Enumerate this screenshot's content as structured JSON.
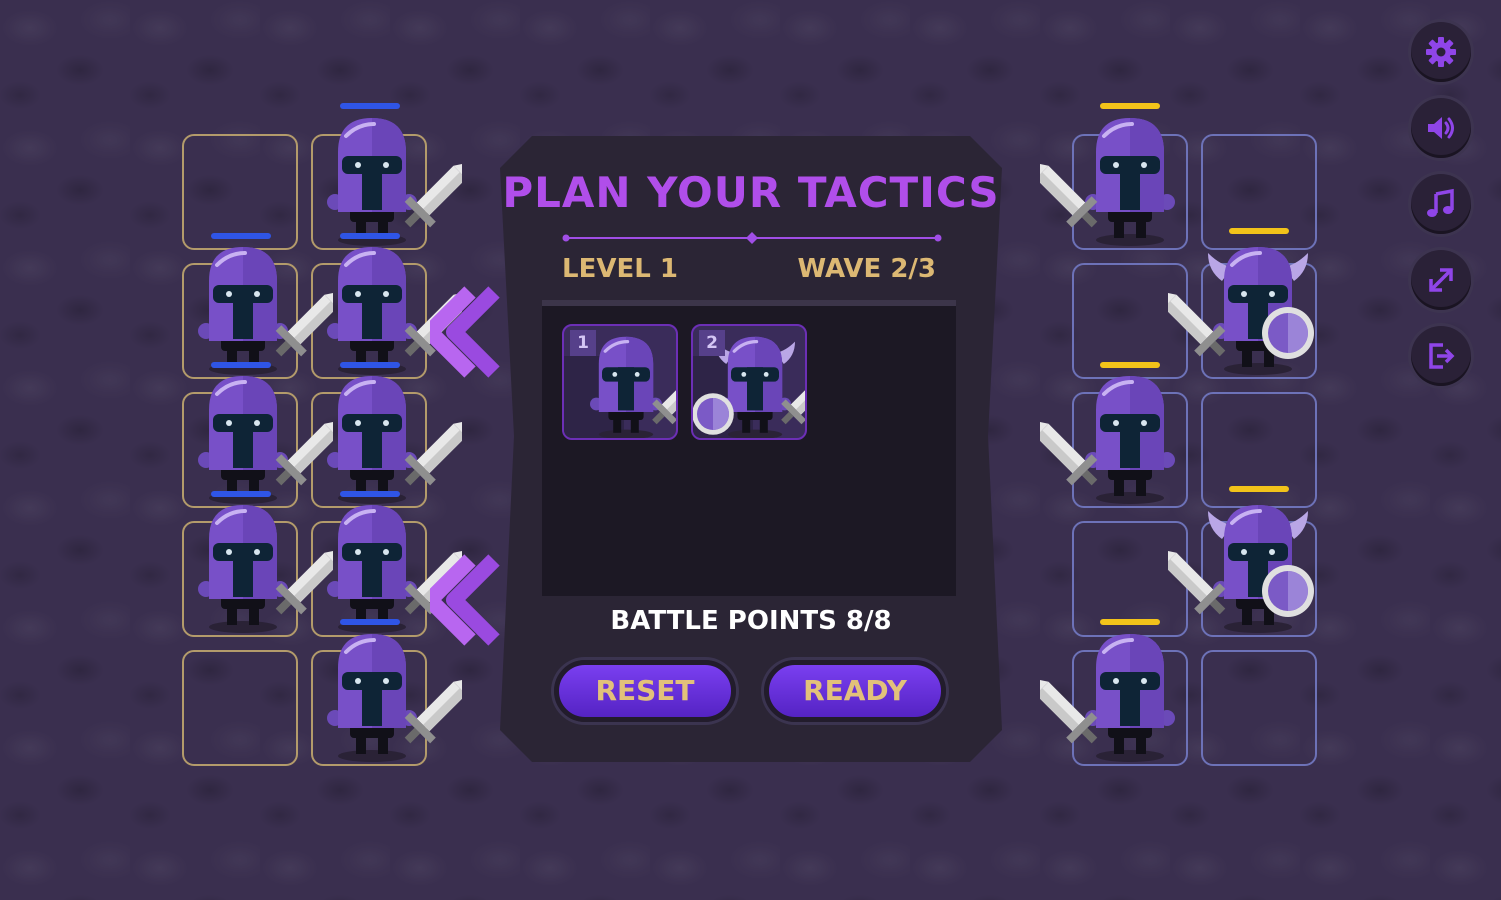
{
  "panel": {
    "title": "PLAN YOUR TACTICS",
    "level": "LEVEL 1",
    "wave": "WAVE 2/3",
    "battle_points": "BATTLE POINTS 8/8",
    "reset_label": "RESET",
    "ready_label": "READY",
    "cards": [
      {
        "number": "1",
        "unit": "sword-knight"
      },
      {
        "number": "2",
        "unit": "viking-shield-knight"
      }
    ]
  },
  "colors": {
    "player_hp": "#2f55e6",
    "enemy_hp": "#f2c31a",
    "title": "#b04eea",
    "gold_text": "#dcb873",
    "button": "#6a34e0"
  },
  "side_buttons": [
    "gear-icon",
    "speaker-icon",
    "music-note-icon",
    "fullscreen-icon",
    "exit-icon"
  ]
}
